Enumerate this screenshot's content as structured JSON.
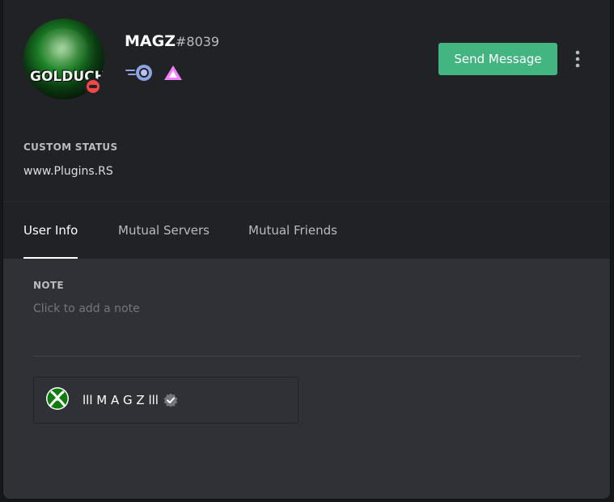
{
  "profile": {
    "avatar_text": "GOLDUCH",
    "username": "MAGZ",
    "discriminator": "#8039",
    "status": "dnd",
    "badges": [
      "nitro-badge-icon",
      "hypesquad-brilliance-icon"
    ]
  },
  "actions": {
    "send_message_label": "Send Message",
    "more_icon": "vertical-ellipsis-icon"
  },
  "custom_status": {
    "title": "CUSTOM STATUS",
    "text": "www.Plugins.RS"
  },
  "tabs": [
    {
      "label": "User Info",
      "active": true
    },
    {
      "label": "Mutual Servers",
      "active": false
    },
    {
      "label": "Mutual Friends",
      "active": false
    }
  ],
  "note": {
    "title": "NOTE",
    "placeholder": "Click to add a note",
    "value": ""
  },
  "connections": [
    {
      "service": "xbox",
      "icon": "xbox-icon",
      "name": "lll M A G Z lll",
      "verified": true
    }
  ],
  "colors": {
    "accent_green": "#43b581",
    "dnd_red": "#f04747",
    "xbox_green": "#107c10",
    "hypesquad_pink": "#f47fff"
  }
}
